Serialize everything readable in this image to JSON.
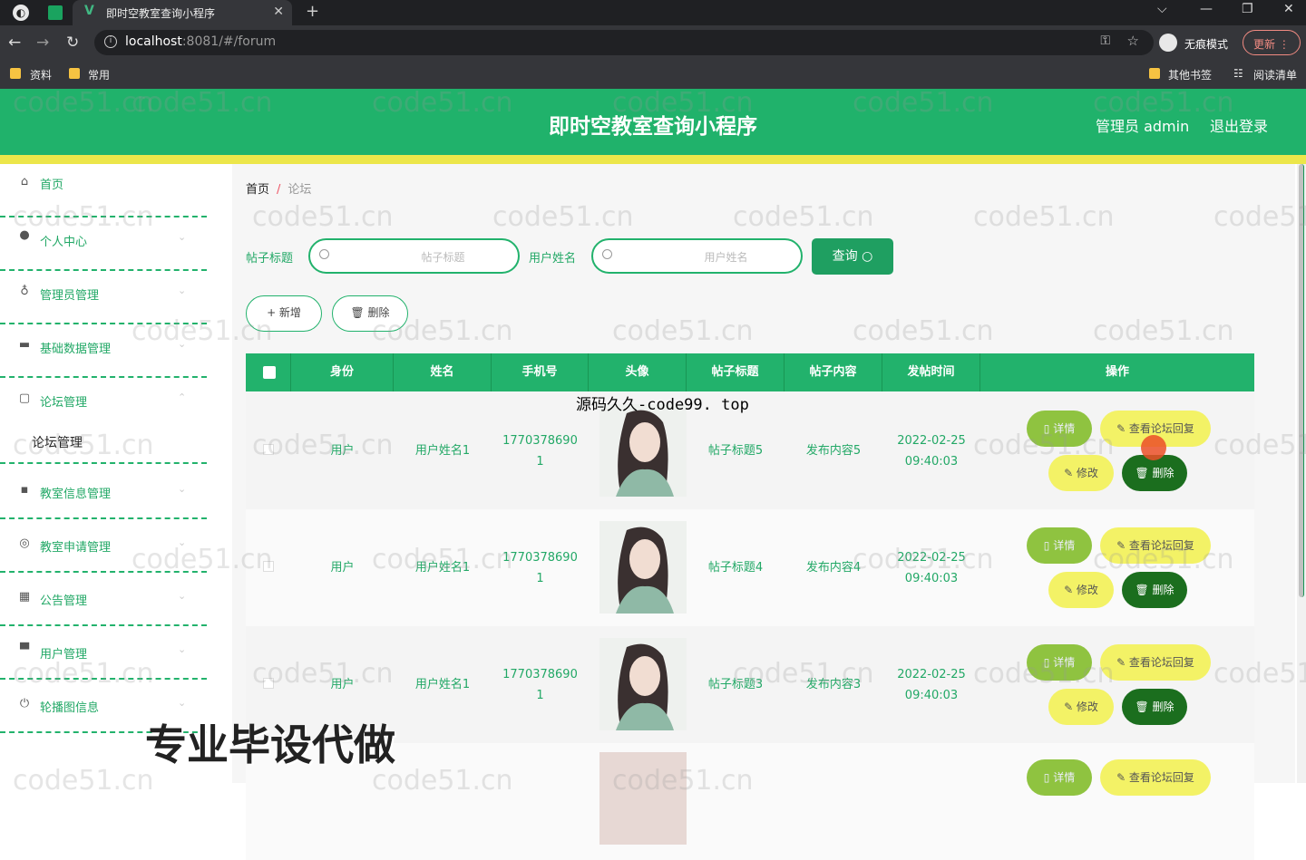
{
  "browser": {
    "tab_title": "即时空教室查询小程序",
    "url_host": "localhost",
    "url_rest": ":8081/#/forum",
    "incognito_label": "无痕模式",
    "update_label": "更新",
    "bookmarks": [
      "资料",
      "常用"
    ],
    "bookmarks_right": [
      "其他书签",
      "阅读清单"
    ]
  },
  "header": {
    "title": "即时空教室查询小程序",
    "user": "管理员 admin",
    "logout": "退出登录"
  },
  "sidebar": {
    "items": [
      {
        "label": "首页",
        "icon": "home-icon"
      },
      {
        "label": "个人中心",
        "icon": "user-icon"
      },
      {
        "label": "管理员管理",
        "icon": "mic-icon"
      },
      {
        "label": "基础数据管理",
        "icon": "briefcase-icon"
      },
      {
        "label": "论坛管理",
        "icon": "square-icon"
      },
      {
        "label": "教室信息管理",
        "icon": "chat-icon"
      },
      {
        "label": "教室申请管理",
        "icon": "globe-icon"
      },
      {
        "label": "公告管理",
        "icon": "mail-icon"
      },
      {
        "label": "用户管理",
        "icon": "printer-icon"
      },
      {
        "label": "轮播图信息",
        "icon": "power-icon"
      }
    ],
    "submenu": "论坛管理"
  },
  "breadcrumb": {
    "home": "首页",
    "sep": "/",
    "current": "论坛"
  },
  "search": {
    "title_label": "帖子标题",
    "title_placeholder": "帖子标题",
    "user_label": "用户姓名",
    "user_placeholder": "用户姓名",
    "query_btn": "查询 ○"
  },
  "actions": {
    "add": "+ 新增",
    "delete": "🗑 删除"
  },
  "table": {
    "headers": [
      "身份",
      "姓名",
      "手机号",
      "头像",
      "帖子标题",
      "帖子内容",
      "发帖时间",
      "操作"
    ],
    "rows": [
      {
        "role": "用户",
        "name": "用户姓名1",
        "phone1": "1770378690",
        "phone2": "1",
        "title": "帖子标题5",
        "content": "发布内容5",
        "date": "2022-02-25",
        "time": "09:40:03"
      },
      {
        "role": "用户",
        "name": "用户姓名1",
        "phone1": "1770378690",
        "phone2": "1",
        "title": "帖子标题4",
        "content": "发布内容4",
        "date": "2022-02-25",
        "time": "09:40:03"
      },
      {
        "role": "用户",
        "name": "用户姓名1",
        "phone1": "1770378690",
        "phone2": "1",
        "title": "帖子标题3",
        "content": "发布内容3",
        "date": "2022-02-25",
        "time": "09:40:03"
      }
    ],
    "btn_detail": "▯ 详情",
    "btn_view_reply": "✎ 查看论坛回复",
    "btn_edit": "✎ 修改",
    "btn_delete": "🗑 删除"
  },
  "overlays": {
    "watermark_text": "code51.cn",
    "source_text": "源码久久-code99. top",
    "ad_text": "专业毕设代做"
  }
}
